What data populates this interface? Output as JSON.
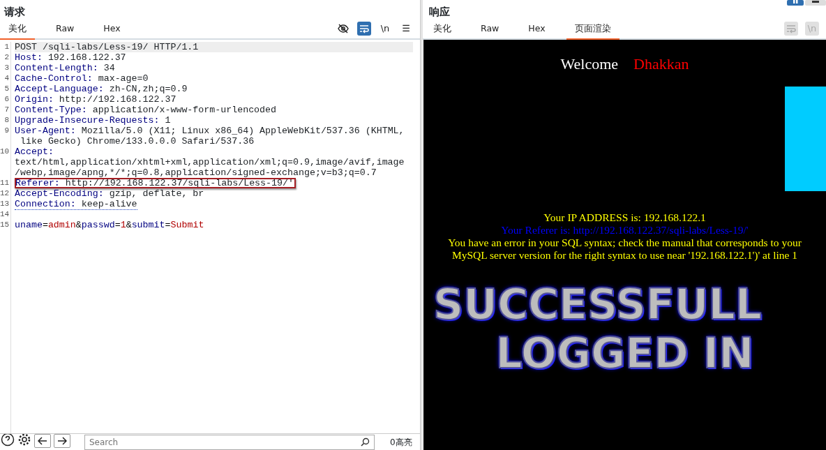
{
  "request": {
    "title": "请求",
    "tabs": [
      {
        "label": "美化",
        "selected": true
      },
      {
        "label": "Raw",
        "selected": false
      },
      {
        "label": "Hex",
        "selected": false
      }
    ],
    "tools": [
      {
        "kind": "hide",
        "on": false
      },
      {
        "kind": "wrap",
        "on": true
      },
      {
        "kind": "newline",
        "text": "\\n",
        "on": false
      },
      {
        "kind": "menu",
        "text": "☰",
        "on": false
      }
    ],
    "lines": [
      {
        "number": "1",
        "kind": "plain",
        "text": "POST /sqli-labs/Less-19/ HTTP/1.1",
        "current": true,
        "boxed": false,
        "underlined": false
      },
      {
        "number": "2",
        "kind": "header",
        "name": "Host:",
        "value_lines": [
          "192.168.122.37"
        ],
        "current": false,
        "boxed": false,
        "underlined": false
      },
      {
        "number": "3",
        "kind": "header",
        "name": "Content-Length:",
        "value_lines": [
          "34"
        ],
        "current": false,
        "boxed": false,
        "underlined": false
      },
      {
        "number": "4",
        "kind": "header",
        "name": "Cache-Control:",
        "value_lines": [
          "max-age=0"
        ],
        "current": false,
        "boxed": false,
        "underlined": false
      },
      {
        "number": "5",
        "kind": "header",
        "name": "Accept-Language:",
        "value_lines": [
          "zh-CN,zh;q=0.9"
        ],
        "current": false,
        "boxed": false,
        "underlined": false
      },
      {
        "number": "6",
        "kind": "header",
        "name": "Origin:",
        "value_lines": [
          "http://192.168.122.37"
        ],
        "current": false,
        "boxed": false,
        "underlined": false
      },
      {
        "number": "7",
        "kind": "header",
        "name": "Content-Type:",
        "value_lines": [
          "application/x-www-form-urlencoded"
        ],
        "current": false,
        "boxed": false,
        "underlined": false
      },
      {
        "number": "8",
        "kind": "header",
        "name": "Upgrade-Insecure-Requests:",
        "value_lines": [
          "1"
        ],
        "current": false,
        "boxed": false,
        "underlined": false
      },
      {
        "number": "9",
        "kind": "header",
        "name": "User-Agent:",
        "value_lines": [
          "Mozilla/5.0 (X11; Linux x86_64) AppleWebKit/537.36 (KHTML,",
          " like Gecko) Chrome/133.0.0.0 Safari/537.36"
        ],
        "current": false,
        "boxed": false,
        "underlined": false
      },
      {
        "number": "10",
        "kind": "header-break",
        "name": "Accept:",
        "value_lines": [
          "text/html,application/xhtml+xml,application/xml;q=0.9,image/avif,image",
          "/webp,image/apng,*/*;q=0.8,application/signed-exchange;v=b3;q=0.7"
        ],
        "current": false,
        "boxed": false,
        "underlined": false
      },
      {
        "number": "11",
        "kind": "header",
        "name": "Referer:",
        "value_lines": [
          "http://192.168.122.37/sqli-labs/Less-19/'"
        ],
        "current": false,
        "boxed": true,
        "underlined": false
      },
      {
        "number": "12",
        "kind": "header",
        "name": "Accept-Encoding:",
        "value_lines": [
          "gzip, deflate, br"
        ],
        "current": false,
        "boxed": false,
        "underlined": false
      },
      {
        "number": "13",
        "kind": "header",
        "name": "Connection:",
        "value_lines": [
          "keep-alive"
        ],
        "current": false,
        "boxed": false,
        "underlined": true
      },
      {
        "number": "14",
        "kind": "blank",
        "current": false,
        "boxed": false,
        "underlined": false
      },
      {
        "number": "15",
        "kind": "body",
        "tokens": [
          {
            "text": "uname",
            "kind": "name"
          },
          {
            "text": "=",
            "kind": "sep"
          },
          {
            "text": "admin",
            "kind": "value"
          },
          {
            "text": "&",
            "kind": "sep"
          },
          {
            "text": "passwd",
            "kind": "name"
          },
          {
            "text": "=",
            "kind": "sep"
          },
          {
            "text": "1",
            "kind": "value"
          },
          {
            "text": "&",
            "kind": "sep"
          },
          {
            "text": "submit",
            "kind": "name"
          },
          {
            "text": "=",
            "kind": "sep"
          },
          {
            "text": "Submit",
            "kind": "value"
          }
        ],
        "current": false,
        "boxed": false,
        "underlined": false
      }
    ],
    "footer": {
      "search": {
        "placeholder": "Search"
      },
      "matches": "0高亮"
    }
  },
  "response": {
    "title": "响应",
    "tabs": [
      {
        "label": "美化",
        "selected": false
      },
      {
        "label": "Raw",
        "selected": false
      },
      {
        "label": "Hex",
        "selected": false
      },
      {
        "label": "页面渲染",
        "selected": true
      }
    ],
    "tools": [
      {
        "kind": "wrap",
        "on": false
      },
      {
        "kind": "newline",
        "text": "\\n",
        "on": false
      }
    ],
    "render": {
      "welcome": "Welcome",
      "name": "Dhakkan",
      "messages": [
        {
          "text": "Your IP ADDRESS is: 192.168.122.1",
          "color": "#ffff00"
        },
        {
          "text": "Your Referer is: http://192.168.122.37/sqli-labs/Less-19/'",
          "color": "#0000ff"
        },
        {
          "text": "You have an error in your SQL syntax; check the manual that corresponds to your MySQL server version for the right syntax to use near '192.168.122.1')' at line 1",
          "color": "#ffff00"
        }
      ],
      "banner": [
        "SUCCESSFULL",
        "LOGGED IN"
      ]
    }
  }
}
